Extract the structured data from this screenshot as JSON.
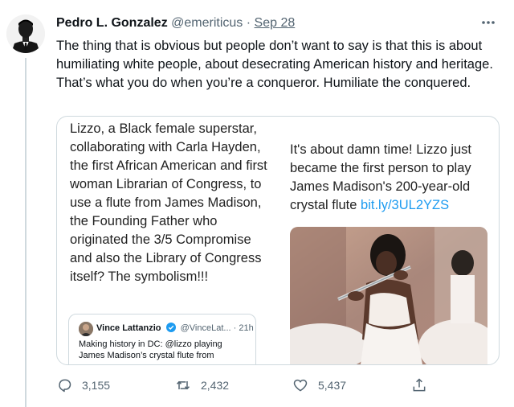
{
  "author": {
    "name": "Pedro L. Gonzalez",
    "handle": "@emeriticus",
    "separator": "·",
    "date": "Sep 28"
  },
  "tweet_text": "The thing that is obvious but people don’t want to say is that this is about humiliating white people, about desecrating American history and heritage. That’s what you do when you’re a conqueror. Humiliate the conquered.",
  "more_icon": "more-horizontal-icon",
  "media": {
    "left_text": "Lizzo, a Black female superstar, collaborating with Carla Hayden, the first African American and first woman Librarian of Congress, to use a flute from James Madison, the Founding Father who originated the 3/5 Compromise and also the Library of Congress itself? The symbolism!!!",
    "quote": {
      "name": "Vince Lattanzio",
      "handle": "@VinceLat...",
      "separator": "·",
      "time": "21h",
      "text": "Making history in DC: @lizzo playing James Madison’s crystal flute from"
    },
    "right_text": "It's about damn time! Lizzo just became the first person to play James Madison's 200-year-old crystal flute",
    "right_link": "bit.ly/3UL2YZS"
  },
  "actions": {
    "reply": {
      "icon": "reply-icon",
      "count": "3,155"
    },
    "retweet": {
      "icon": "retweet-icon",
      "count": "2,432"
    },
    "like": {
      "icon": "heart-icon",
      "count": "5,437"
    },
    "share": {
      "icon": "share-icon"
    }
  },
  "colors": {
    "link": "#1d9bf0",
    "secondary_text": "#536471",
    "border": "#cfd9de",
    "verified": "#1d9bf0"
  }
}
